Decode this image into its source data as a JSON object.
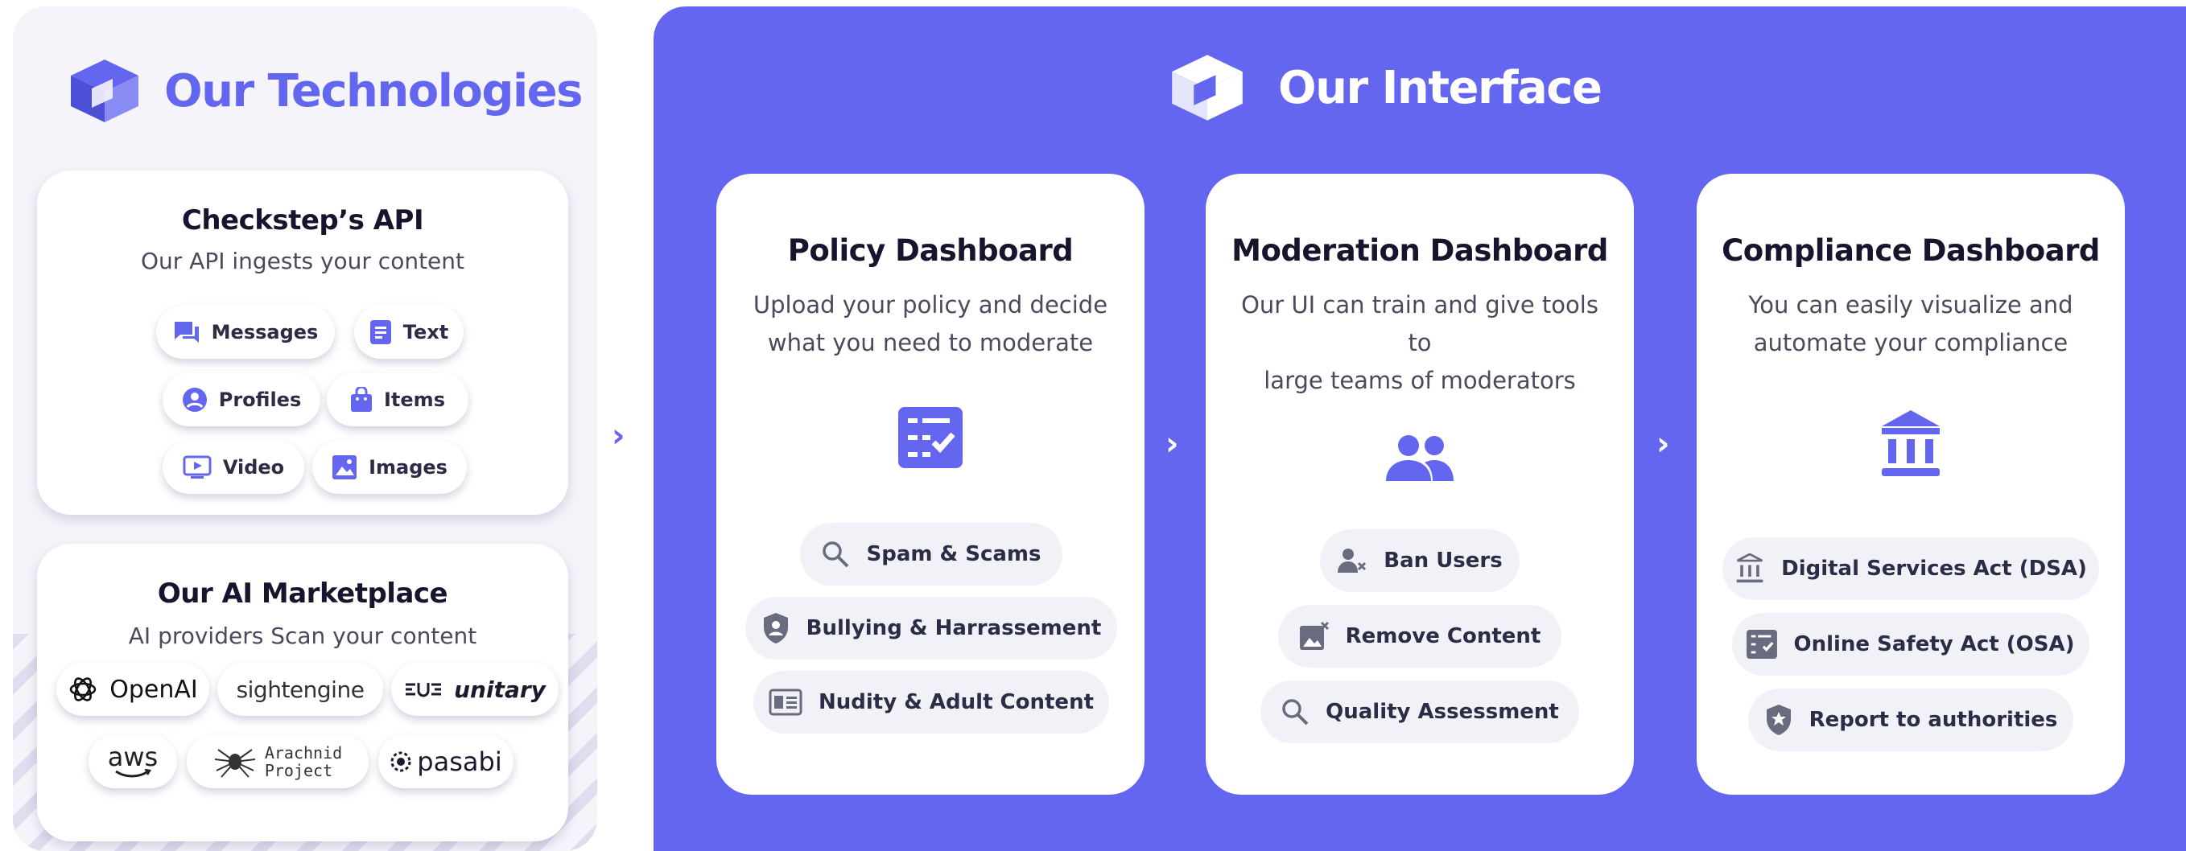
{
  "colors": {
    "accent": "#6466ef",
    "panel_bg": "#f5f4fa",
    "chip_bg": "#f1f1f8",
    "text_dark": "#16152d"
  },
  "technologies": {
    "title": "Our Technologies",
    "logo_icon": "cube-logo-icon",
    "api_card": {
      "title": "Checkstep’s API",
      "subtitle": "Our API ingests your content",
      "items": [
        {
          "label": "Messages",
          "icon": "chat-bubbles-icon"
        },
        {
          "label": "Text",
          "icon": "document-text-icon"
        },
        {
          "label": "Profiles",
          "icon": "user-circle-icon"
        },
        {
          "label": "Items",
          "icon": "shopping-bag-icon"
        },
        {
          "label": "Video",
          "icon": "video-play-icon"
        },
        {
          "label": "Images",
          "icon": "image-icon"
        }
      ]
    },
    "marketplace_card": {
      "title": "Our AI Marketplace",
      "subtitle": "AI providers Scan your content",
      "providers": [
        {
          "label": "OpenAI",
          "icon": "openai-logo-icon"
        },
        {
          "label": "sightengine"
        },
        {
          "label": "unitary",
          "icon": "unitary-logo-icon"
        },
        {
          "label": "aws",
          "icon": "aws-smile-icon"
        },
        {
          "label": "Arachnid",
          "label2": "Project",
          "icon": "spider-logo-icon"
        },
        {
          "label": "pasabi",
          "icon": "pasabi-logo-icon"
        }
      ]
    }
  },
  "interface": {
    "title": "Our Interface",
    "logo_icon": "cube-logo-icon",
    "dashboards": [
      {
        "title": "Policy Dashboard",
        "description": [
          "Upload your policy and decide",
          "what you need to moderate"
        ],
        "icon": "checklist-icon",
        "chips": [
          {
            "label": "Spam & Scams",
            "icon": "search-icon"
          },
          {
            "label": "Bullying  & Harrassement",
            "icon": "shield-user-icon"
          },
          {
            "label": "Nudity & Adult Content",
            "icon": "id-card-icon"
          }
        ]
      },
      {
        "title": "Moderation Dashboard",
        "description": [
          "Our UI can train and give tools to",
          "large teams of moderators"
        ],
        "icon": "users-group-icon",
        "chips": [
          {
            "label": "Ban Users",
            "icon": "user-remove-icon"
          },
          {
            "label": "Remove Content",
            "icon": "image-remove-icon"
          },
          {
            "label": "Quality Assessment",
            "icon": "search-icon"
          }
        ]
      },
      {
        "title": "Compliance Dashboard",
        "description": [
          "You can easily visualize and",
          "automate your compliance"
        ],
        "icon": "bank-building-icon",
        "chips": [
          {
            "label": "Digital Services Act (DSA)",
            "icon": "bank-building-icon"
          },
          {
            "label": "Online Safety Act (OSA)",
            "icon": "checklist-icon"
          },
          {
            "label": "Report to authorities",
            "icon": "shield-star-icon"
          }
        ]
      }
    ],
    "arrows": [
      "›",
      "›",
      "›"
    ]
  }
}
